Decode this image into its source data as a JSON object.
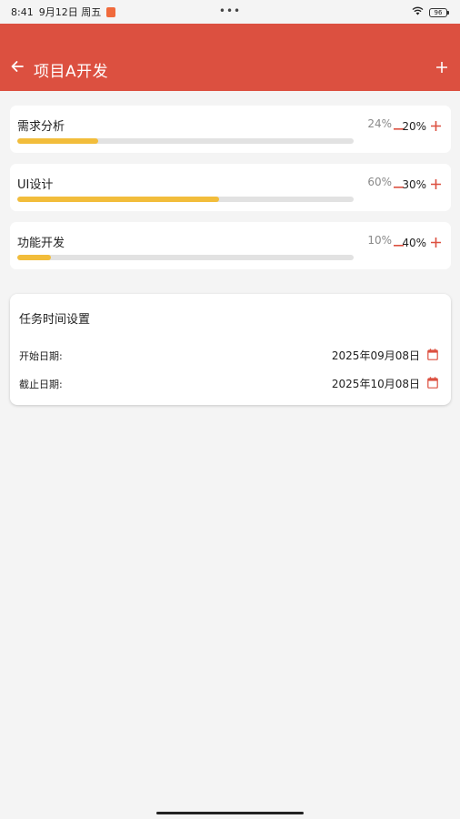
{
  "status_bar": {
    "time": "8:41",
    "date": "9月12日 周五",
    "center_dots": "•••",
    "battery": "96"
  },
  "app_bar": {
    "title": "项目A开发",
    "background": "#dc5040"
  },
  "tasks": [
    {
      "name": "需求分析",
      "progress_text": "24%",
      "progress": 0.24,
      "step": "20%"
    },
    {
      "name": "UI设计",
      "progress_text": "60%",
      "progress": 0.6,
      "step": "30%"
    },
    {
      "name": "功能开发",
      "progress_text": "10%",
      "progress": 0.1,
      "step": "40%"
    }
  ],
  "settings": {
    "title": "任务时间设置",
    "start_label": "开始日期:",
    "start_value": "2025年09月08日",
    "end_label": "截止日期:",
    "end_value": "2025年10月08日"
  },
  "colors": {
    "accent": "#dc5040",
    "progress": "#f2bd3b",
    "track": "#e2e2e2"
  },
  "icons": {
    "back": "arrow-left-icon",
    "add": "plus-icon",
    "minus": "minus-icon",
    "calendar": "calendar-icon"
  }
}
